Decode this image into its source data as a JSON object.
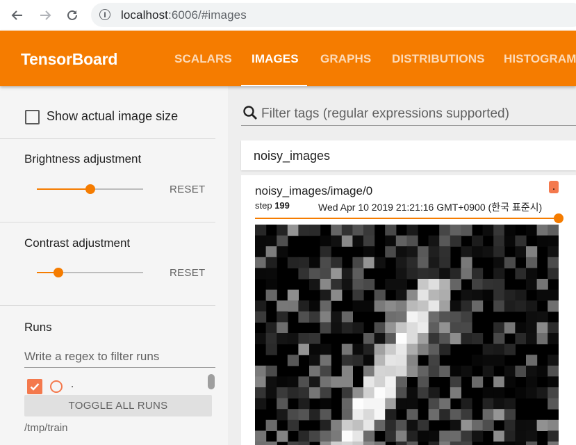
{
  "browser": {
    "url_host": "localhost",
    "url_path": ":6006/#images",
    "icons": {
      "back": "arrow-left-icon",
      "forward": "arrow-right-icon",
      "reload": "reload-icon",
      "info": "info-icon"
    }
  },
  "app": {
    "title": "TensorBoard",
    "accent_color": "#f57c00",
    "tabs": [
      {
        "label": "SCALARS",
        "active": false
      },
      {
        "label": "IMAGES",
        "active": true
      },
      {
        "label": "GRAPHS",
        "active": false
      },
      {
        "label": "DISTRIBUTIONS",
        "active": false
      },
      {
        "label": "HISTOGRAMS",
        "active": false
      }
    ]
  },
  "sidebar": {
    "show_actual_size": {
      "label": "Show actual image size",
      "checked": false
    },
    "brightness": {
      "label": "Brightness adjustment",
      "value": 0.5,
      "reset_label": "RESET"
    },
    "contrast": {
      "label": "Contrast adjustment",
      "value": 0.2,
      "reset_label": "RESET"
    },
    "runs": {
      "title": "Runs",
      "filter_placeholder": "Write a regex to filter runs",
      "items": [
        {
          "name": ".",
          "checked": true,
          "color": "#f4794d"
        }
      ],
      "toggle_label": "TOGGLE ALL RUNS",
      "path": "/tmp/train"
    }
  },
  "main": {
    "search_placeholder": "Filter tags (regular expressions supported)",
    "category": "noisy_images",
    "card": {
      "title": "noisy_images/image/0",
      "step_label": "step",
      "step_value": "199",
      "timestamp": "Wed Apr 10 2019 21:21:16 GMT+0900 (한국 표준시)",
      "run_color": "#f4794d",
      "step_position": 1.0
    }
  }
}
